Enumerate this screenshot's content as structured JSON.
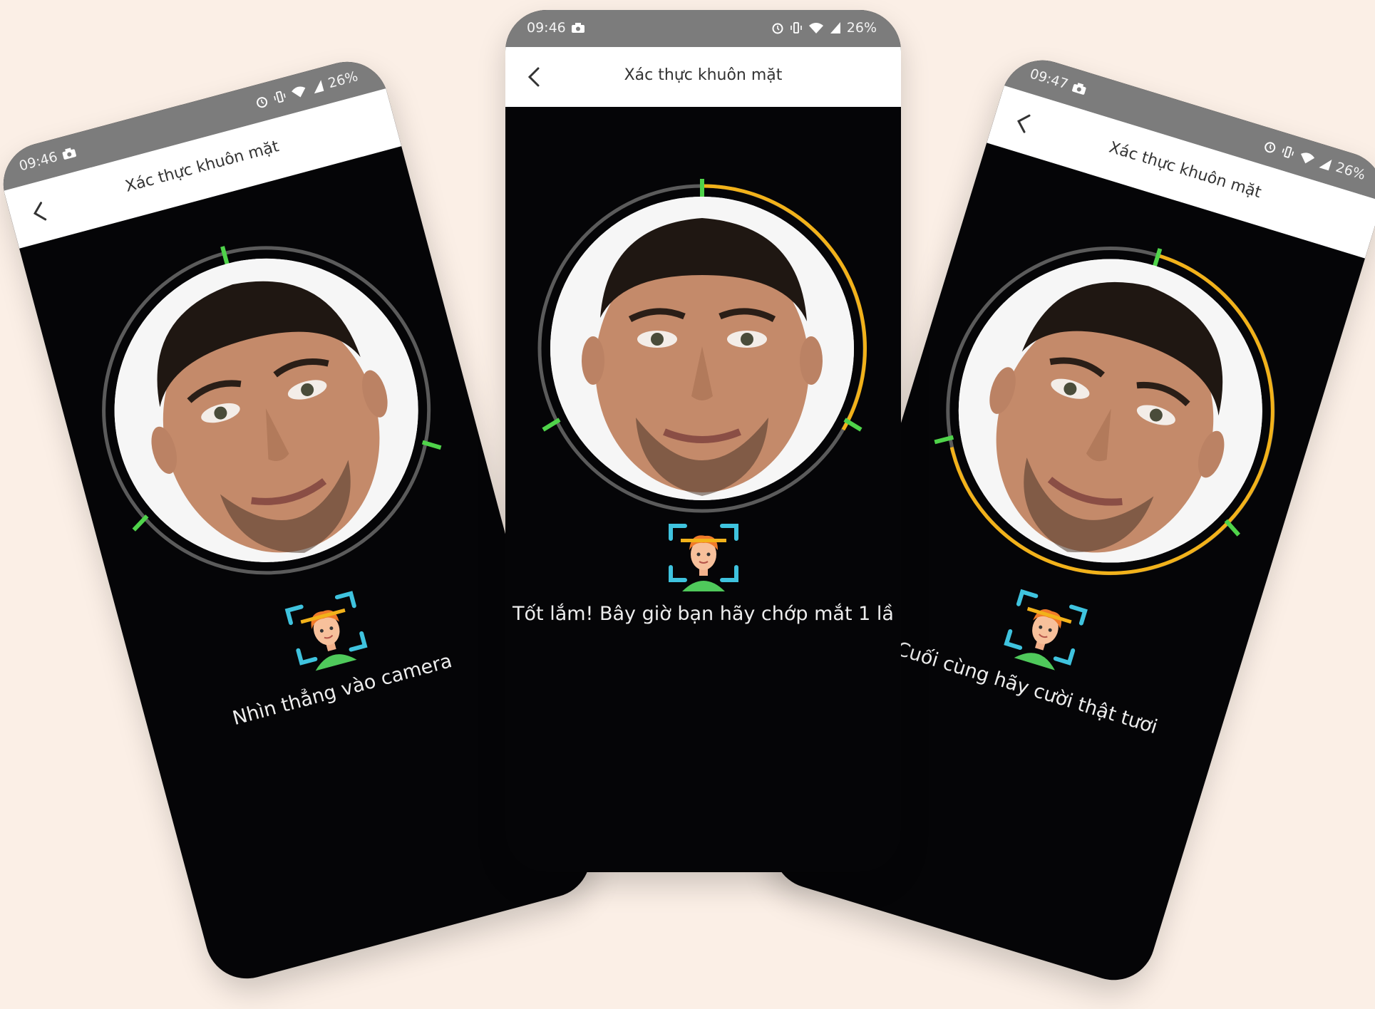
{
  "colors": {
    "background": "#fbefe6",
    "screen": "#050507",
    "statusbar": "#7c7c7c",
    "ring_track": "#5b5b5b",
    "ring_progress": "#f2b21a",
    "tick": "#4fd34a",
    "guide_frame": "#3fc3de"
  },
  "screens": [
    {
      "status_time": "09:46",
      "battery": "26%",
      "title": "Xác thực khuôn mặt",
      "instruction": "Nhìn thẳng vào camera",
      "progress": 0,
      "icons": [
        "camera-icon",
        "alarm-icon",
        "vibrate-icon",
        "wifi-icon",
        "signal-icon",
        "back-icon"
      ]
    },
    {
      "status_time": "09:46",
      "battery": "26%",
      "title": "Xác thực khuôn mặt",
      "instruction": "Tốt lắm! Bây giờ bạn hãy chớp mắt 1 lầ",
      "progress": 0.33,
      "icons": [
        "camera-icon",
        "alarm-icon",
        "vibrate-icon",
        "wifi-icon",
        "signal-icon",
        "back-icon"
      ]
    },
    {
      "status_time": "09:47",
      "battery": "26%",
      "title": "Xác thực khuôn mặt",
      "instruction": "Cuối cùng hãy cười thật tươi",
      "progress": 0.66,
      "icons": [
        "camera-icon",
        "alarm-icon",
        "vibrate-icon",
        "wifi-icon",
        "signal-icon",
        "back-icon"
      ]
    }
  ]
}
